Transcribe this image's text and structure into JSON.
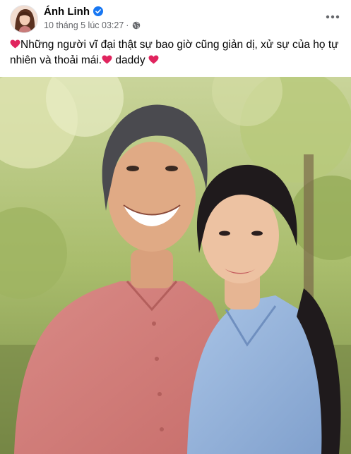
{
  "post": {
    "author": "Ánh Linh",
    "verified_icon": "verified-badge-icon",
    "timestamp": "10 tháng 5 lúc 03:27",
    "separator": "·",
    "audience_icon": "globe-icon",
    "more_icon": "more-options-icon",
    "caption_part1": "Những người vĩ đại thật sự bao giờ cũng giản dị, xử sự của họ tự nhiên và thoải mái.",
    "caption_part2": " daddy ",
    "photo_icon": "post-photo"
  },
  "colors": {
    "verified": "#1877f2",
    "meta": "#65676b",
    "heart": "#e0245e"
  }
}
